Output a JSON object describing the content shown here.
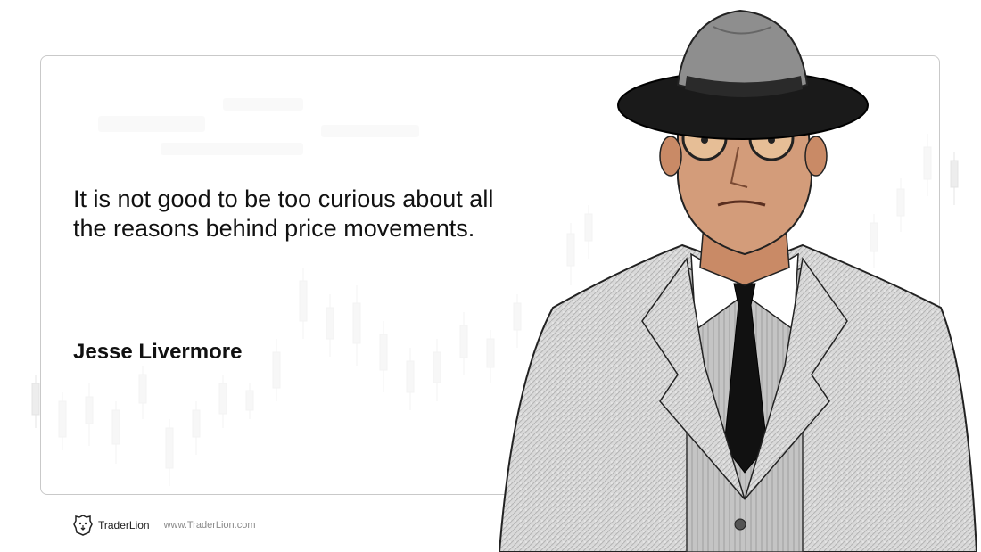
{
  "quote": {
    "text": "It is not good to be too curious about all the reasons behind price movements.",
    "author": "Jesse Livermore"
  },
  "footer": {
    "brand": "TraderLion",
    "url": "www.TraderLion.com",
    "logo_icon": "lion-head-icon"
  },
  "portrait": {
    "subject": "Jesse Livermore"
  },
  "colors": {
    "text": "#111111",
    "card_border": "#c9c9c9",
    "muted": "#8a8a8a",
    "hat": "#8e8e8e",
    "brim": "#1a1a1a",
    "skin": "#d39c7a",
    "suit": "#d7d7d7"
  }
}
